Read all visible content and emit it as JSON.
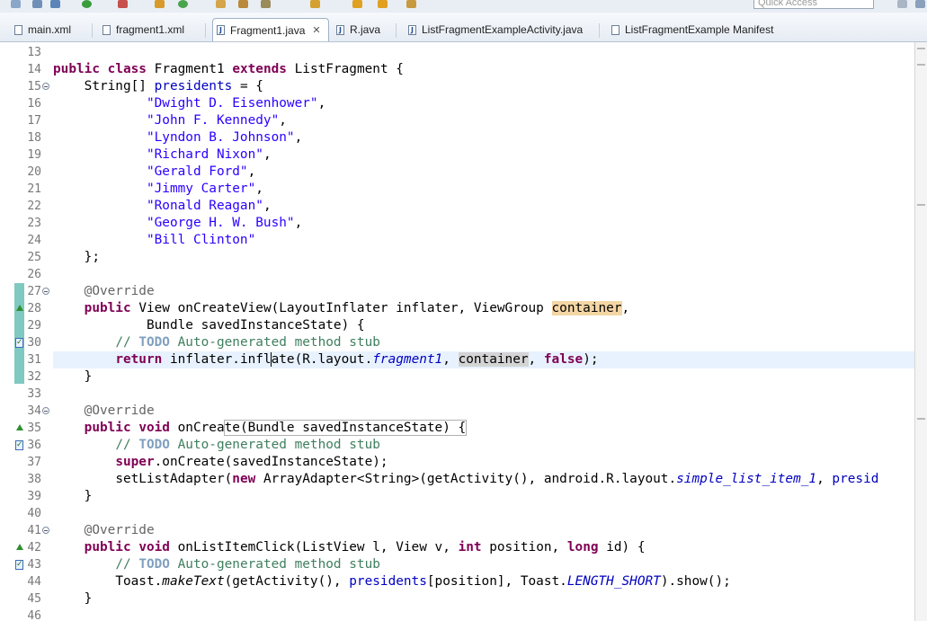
{
  "quick_access": {
    "placeholder": "Quick Access"
  },
  "tabs": [
    {
      "label": "main.xml",
      "icon": "xml-file-icon",
      "active": false
    },
    {
      "label": "fragment1.xml",
      "icon": "xml-file-icon",
      "active": false
    },
    {
      "label": "Fragment1.java",
      "icon": "java-file-icon",
      "active": true
    },
    {
      "label": "R.java",
      "icon": "java-file-icon",
      "active": false
    },
    {
      "label": "ListFragmentExampleActivity.java",
      "icon": "java-file-icon",
      "active": false
    },
    {
      "label": "ListFragmentExample Manifest",
      "icon": "manifest-file-icon",
      "active": false
    }
  ],
  "tab_close_glyph": "✕",
  "editor": {
    "lines": [
      {
        "n": "13"
      },
      {
        "n": "14"
      },
      {
        "n": "15"
      },
      {
        "n": "16",
        "text": "\"Dwight D. Eisenhower\""
      },
      {
        "n": "17",
        "text": "\"John F. Kennedy\""
      },
      {
        "n": "18",
        "text": "\"Lyndon B. Johnson\""
      },
      {
        "n": "19",
        "text": "\"Richard Nixon\""
      },
      {
        "n": "20",
        "text": "\"Gerald Ford\""
      },
      {
        "n": "21",
        "text": "\"Jimmy Carter\""
      },
      {
        "n": "22",
        "text": "\"Ronald Reagan\""
      },
      {
        "n": "23",
        "text": "\"George H. W. Bush\""
      },
      {
        "n": "24",
        "text": "\"Bill Clinton\""
      },
      {
        "n": "25"
      },
      {
        "n": "26"
      },
      {
        "n": "27"
      },
      {
        "n": "28"
      },
      {
        "n": "29"
      },
      {
        "n": "30"
      },
      {
        "n": "31"
      },
      {
        "n": "32"
      },
      {
        "n": "33"
      },
      {
        "n": "34"
      },
      {
        "n": "35"
      },
      {
        "n": "36"
      },
      {
        "n": "37"
      },
      {
        "n": "38"
      },
      {
        "n": "39"
      },
      {
        "n": "40"
      },
      {
        "n": "41"
      },
      {
        "n": "42"
      },
      {
        "n": "43"
      },
      {
        "n": "44"
      },
      {
        "n": "45"
      },
      {
        "n": "46"
      }
    ],
    "tokens": {
      "public": "public",
      "class": "class",
      "extends": "extends",
      "void": "void",
      "return": "return",
      "super": "super",
      "new": "new",
      "int": "int",
      "long": "long",
      "false": "false",
      "class_name": "Fragment1",
      "super_class": "ListFragment",
      "open_brace": "{",
      "string_array": "String[]",
      "presidents": "presidents",
      "assign_open": "= {",
      "close_array": "};",
      "close_brace": "}",
      "override": "@Override",
      "view_type": "View",
      "on_create_view_sig": "onCreateView(LayoutInflater inflater, ViewGroup",
      "container": "container",
      "bundle_param": "Bundle savedInstanceState) {",
      "comment_slashes": "//",
      "todo": "TODO",
      "todo_rest": "Auto-generated method stub",
      "inflater_call_a": "inflater.infl",
      "inflater_call_b": "ate(R.layout.",
      "fragment1": "fragment1",
      "on_create_a": "onCrea",
      "on_create_b": "te(Bundle savedInstanceState) {",
      "super_on_create": ".onCreate(savedInstanceState);",
      "set_list_adapter": "setListAdapter(",
      "array_adapter": "ArrayAdapter<String>(getActivity(), android.R.layout.",
      "simple_list_item_1": "simple_list_item_1",
      "presid": "presid",
      "on_list_item_click": "onListItemClick(ListView l, View v,",
      "position": "position,",
      "id_param": "id) {",
      "toast": "Toast.",
      "make_text": "makeText",
      "get_activity": "(getActivity(),",
      "position_idx": "[position], Toast.",
      "length_short": "LENGTH_SHORT",
      "show": ").show();"
    }
  }
}
